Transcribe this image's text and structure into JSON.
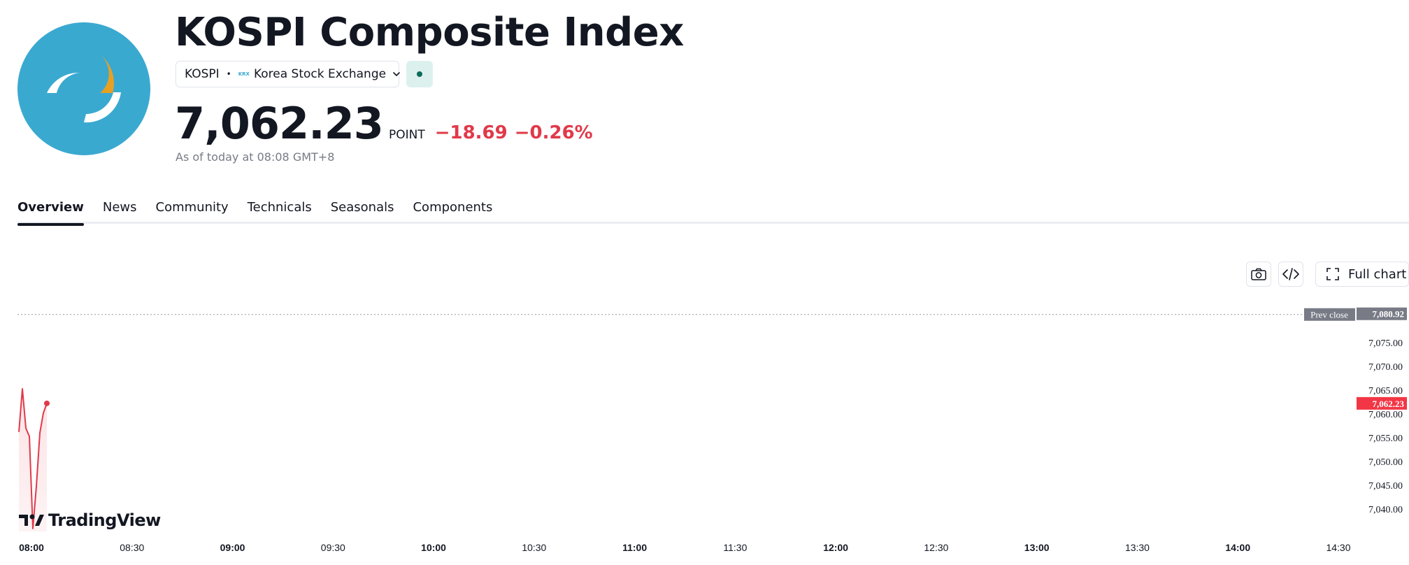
{
  "header": {
    "title": "KOSPI Composite Index",
    "symbol": "KOSPI",
    "separator": "•",
    "exchange_logo_text": "KRX",
    "exchange": "Korea Stock Exchange",
    "price": "7,062.23",
    "unit": "POINT",
    "change": "−18.69",
    "change_percent": "−0.26%",
    "as_of": "As of today at 08:08 GMT+8"
  },
  "tabs": [
    {
      "label": "Overview",
      "active": true
    },
    {
      "label": "News"
    },
    {
      "label": "Community"
    },
    {
      "label": "Technicals"
    },
    {
      "label": "Seasonals"
    },
    {
      "label": "Components"
    }
  ],
  "toolbar": {
    "camera_icon": "camera-icon",
    "embed_icon": "code-icon",
    "full_chart_label": "Full chart",
    "full_chart_icon": "expand-icon"
  },
  "branding": {
    "tradingview_label": "TradingView"
  },
  "colors": {
    "accent_blue": "#3aa9d0",
    "logo_orange": "#e8a023",
    "down_red": "#e03a4a",
    "prev_close_gray": "#787b86",
    "status_green": "#0d6b5a"
  },
  "chart_data": {
    "type": "line",
    "x": [
      "08:00",
      "08:01",
      "08:02",
      "08:03",
      "08:04",
      "08:05",
      "08:06",
      "08:07",
      "08:08"
    ],
    "y": [
      7056.2,
      7065.3,
      7057.0,
      7055.3,
      7035.9,
      7044.8,
      7056.0,
      7060.2,
      7062.23
    ],
    "x_ticks": [
      {
        "label": "08:00",
        "bold": true
      },
      {
        "label": "08:30"
      },
      {
        "label": "09:00",
        "bold": true
      },
      {
        "label": "09:30"
      },
      {
        "label": "10:00",
        "bold": true
      },
      {
        "label": "10:30"
      },
      {
        "label": "11:00",
        "bold": true
      },
      {
        "label": "11:30"
      },
      {
        "label": "12:00",
        "bold": true
      },
      {
        "label": "12:30"
      },
      {
        "label": "13:00",
        "bold": true
      },
      {
        "label": "13:30"
      },
      {
        "label": "14:00",
        "bold": true
      },
      {
        "label": "14:30"
      }
    ],
    "x_range": [
      "08:00",
      "14:30"
    ],
    "y_ticks": [
      "7,075.00",
      "7,070.00",
      "7,065.00",
      "7,060.00",
      "7,055.00",
      "7,050.00",
      "7,045.00",
      "7,040.00"
    ],
    "y_tick_values": [
      7075,
      7070,
      7065,
      7060,
      7055,
      7050,
      7045,
      7040
    ],
    "prev_close": {
      "label": "Prev close",
      "value": 7080.92,
      "value_label": "7,080.92"
    },
    "last_price": {
      "value": 7062.23,
      "value_label": "7,062.23"
    },
    "grid": false,
    "line_color": "#e03a4a"
  }
}
